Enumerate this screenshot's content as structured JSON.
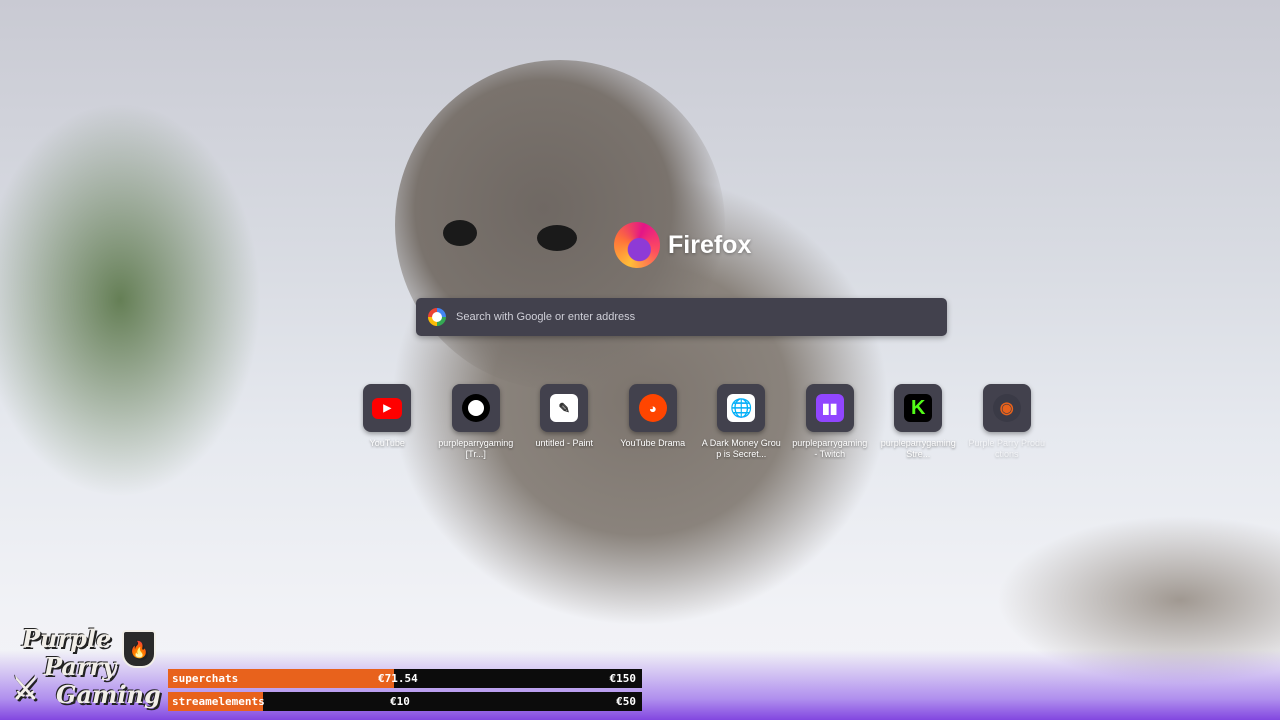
{
  "browser": {
    "brand_name": "Firefox",
    "search_placeholder": "Search with Google or enter address"
  },
  "top_sites": [
    {
      "label": "YouTube",
      "icon": "youtube-icon",
      "color": "#ff0000"
    },
    {
      "label": "purpleparrygaming [Tr...]",
      "icon": "patreon-icon",
      "color": "#000000"
    },
    {
      "label": "untitled - Paint",
      "icon": "paint-icon",
      "color": "#ffffff"
    },
    {
      "label": "YouTube Drama",
      "icon": "reddit-icon",
      "color": "#ff4500"
    },
    {
      "label": "A Dark Money Group is Secret...",
      "icon": "globe-page-icon",
      "color": "#ffffff"
    },
    {
      "label": "purpleparrygaming - Twitch",
      "icon": "twitch-icon",
      "color": "#9146ff"
    },
    {
      "label": "purpleparrygaming Stre...",
      "icon": "kick-icon",
      "color": "#53fc18"
    },
    {
      "label": "Purple Parry Productions",
      "icon": "stream-icon",
      "color": "#e8621c"
    }
  ],
  "overlay": {
    "brand_lines": [
      "Purple",
      "Parry",
      "Gaming"
    ],
    "goals": [
      {
        "name": "superchats",
        "current": "€71.54",
        "goal": "€150",
        "progress": 0.477
      },
      {
        "name": "streamelements",
        "current": "€10",
        "goal": "€50",
        "progress": 0.2
      }
    ]
  }
}
